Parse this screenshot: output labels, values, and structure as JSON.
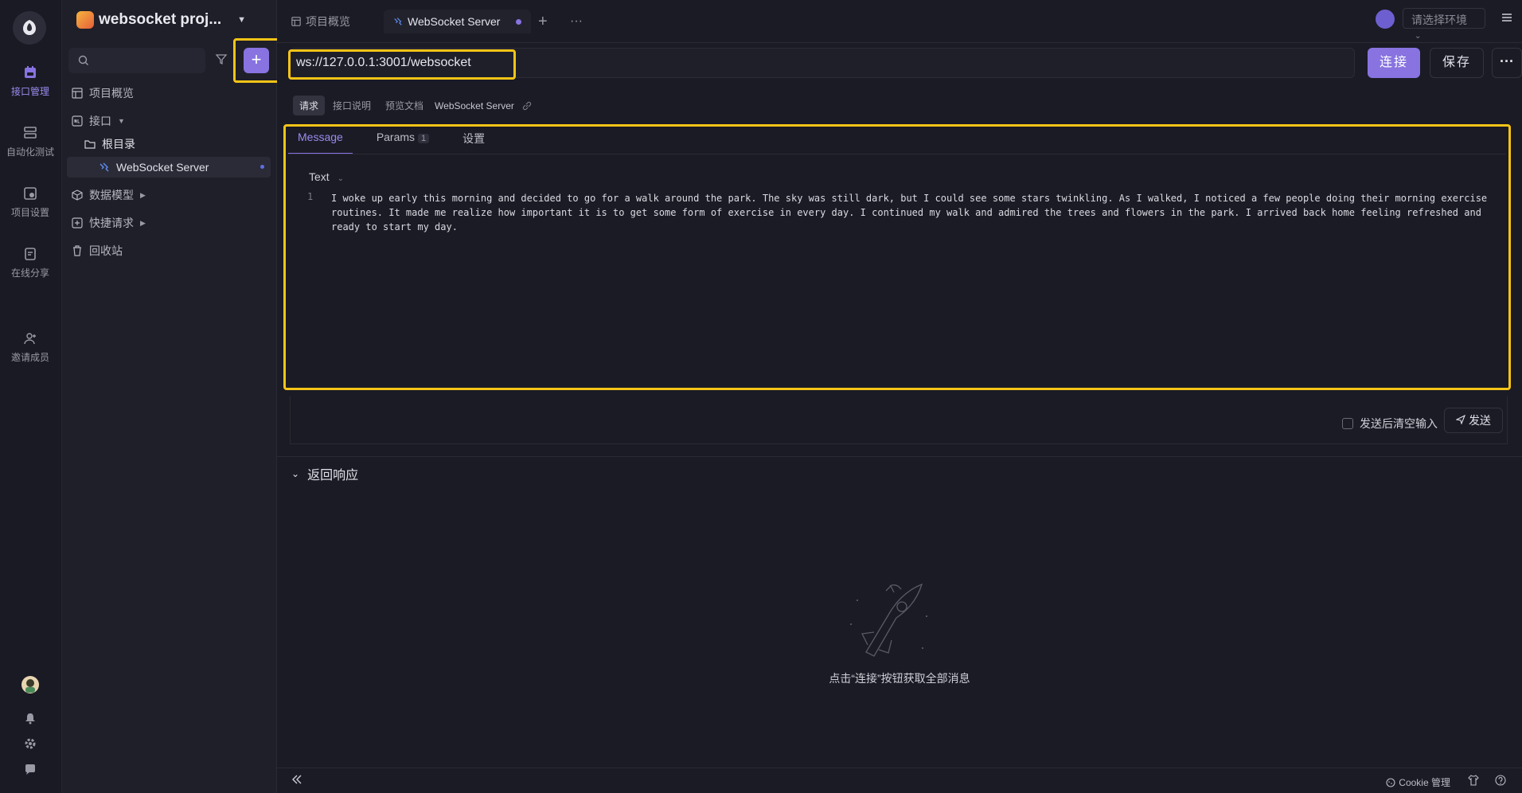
{
  "rail": {
    "items": [
      {
        "label": "接口管理",
        "active": true
      },
      {
        "label": "自动化测试"
      },
      {
        "label": "项目设置"
      },
      {
        "label": "在线分享"
      },
      {
        "label": "邀请成员"
      }
    ]
  },
  "sidebar": {
    "project_name": "websocket proj...",
    "tree": {
      "overview": "项目概览",
      "api": "接口",
      "root_dir": "根目录",
      "ws_server": "WebSocket Server",
      "data_models": "数据模型",
      "quick_requests": "快捷请求",
      "recycle_bin": "回收站"
    }
  },
  "tabs": {
    "items": [
      {
        "label": "项目概览"
      },
      {
        "label": "WebSocket Server",
        "active": true
      }
    ],
    "add": "+",
    "more": "···"
  },
  "env": {
    "placeholder": "请选择环境"
  },
  "request": {
    "url": "ws://127.0.0.1:3001/websocket",
    "connect_label": "连接",
    "save_label": "保存",
    "more_label": "···"
  },
  "subtabs": {
    "request": "请求",
    "doc": "接口说明",
    "preview": "预览文档",
    "title": "WebSocket Server"
  },
  "message": {
    "tabs": {
      "message": "Message",
      "params": "Params",
      "params_count": "1",
      "settings": "设置"
    },
    "type": "Text",
    "line_number": "1",
    "body": "I woke up early this morning and decided to go for a walk around the park. The sky was still dark, but I could see some stars twinkling. As I walked, I noticed a few people doing their morning exercise routines. It made me realize how important it is to get some form of exercise in every day. I continued my walk and admired the trees and flowers in the park. I arrived back home feeling refreshed and ready to start my day."
  },
  "send": {
    "clear_after_send": "发送后清空输入",
    "send_label": "发送"
  },
  "response": {
    "title": "返回响应",
    "hint": "点击“连接”按钮获取全部消息"
  },
  "footer": {
    "cookie": "Cookie 管理"
  },
  "colors": {
    "accent": "#8873e0",
    "highlight": "#f6c416",
    "background": "#1b1b25"
  }
}
